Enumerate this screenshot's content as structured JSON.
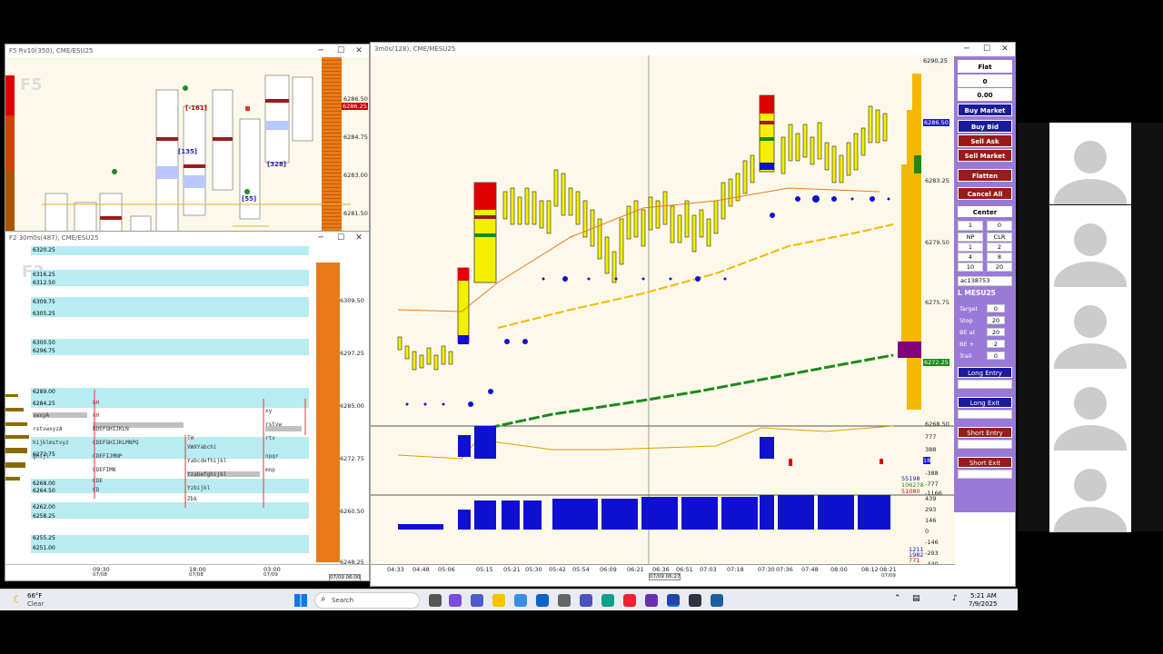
{
  "windows": {
    "f5": {
      "title": "F5 Rv10(350), CME/ESU25",
      "watermark": "F5",
      "prices": [
        "6286.50",
        "6286.25",
        "6284.75",
        "6283.00",
        "6281.50"
      ]
    },
    "f2": {
      "title": "F2 30m0s(487), CME/ESU25",
      "watermark": "F2",
      "levels": [
        "6320.25",
        "6316.25",
        "6312.50",
        "6309.75",
        "6305.25",
        "6300.50",
        "6296.75",
        "6289.00",
        "6284.25",
        "6272.75",
        "6268.00",
        "6264.50",
        "6262.00",
        "6258.25",
        "6255.25",
        "6251.00"
      ],
      "right_prices": [
        "6309.50",
        "6297.25",
        "6285.00",
        "6272.75",
        "6260.50",
        "6248.25"
      ],
      "time_labels": [
        "09:30",
        "18:00",
        "03:00"
      ],
      "date_labels": [
        "07/08",
        "07/08",
        "07/09"
      ],
      "cursor": "07/09 06:00"
    },
    "main": {
      "title": "3m0s(128), CME/MESU25",
      "prices": [
        "6290.25",
        "6286.50",
        "6283.25",
        "6279.50",
        "6275.75",
        "6272.25",
        "6268.50"
      ],
      "ind1": [
        "777",
        "388",
        "18",
        "-388",
        "-777",
        "-1166"
      ],
      "ind2": [
        "439",
        "293",
        "146",
        "0",
        "-146",
        "-293",
        "-440"
      ],
      "readouts": [
        "55198",
        "106278",
        "51080",
        "1211",
        "1982",
        "771"
      ],
      "times": [
        "04:33",
        "04:48",
        "05:06",
        "05:15",
        "05:21",
        "05:30",
        "05:42",
        "05:54",
        "06:09",
        "06:21",
        "06:36",
        "06:51",
        "07:03",
        "07:18",
        "07:30",
        "07:36",
        "07:48",
        "08:00",
        "08:12",
        "08:21"
      ],
      "cursor": "07/09 06:27",
      "last_date": "07/09"
    }
  },
  "panel": {
    "status": "Flat",
    "position": "0",
    "pnl": "0.00",
    "buy_market": "Buy Market",
    "buy_bid": "Buy Bid",
    "sell_ask": "Sell Ask",
    "sell_market": "Sell Market",
    "flatten": "Flatten",
    "cancel_all": "Cancel All",
    "center": "Center",
    "qty": "1",
    "qty2": "0",
    "grid": [
      "NP",
      "CLR",
      "1",
      "2",
      "4",
      "8",
      "10",
      "20"
    ],
    "account": "ac138753",
    "instrument": "L MESU25",
    "target_label": "Target",
    "target": "0",
    "stop_label": "Stop",
    "stop": "20",
    "beat_label": "BE at",
    "beat": "20",
    "beplus_label": "BE +",
    "beplus": "2",
    "trail_label": "Trail",
    "trail": "0",
    "long_entry": "Long Entry",
    "long_exit": "Long Exit",
    "short_entry": "Short Entry",
    "short_exit": "Short Exit"
  },
  "taskbar": {
    "temp": "66°F",
    "weather": "Clear",
    "search": "Search",
    "time": "5:21 AM",
    "date": "7/9/2025"
  }
}
